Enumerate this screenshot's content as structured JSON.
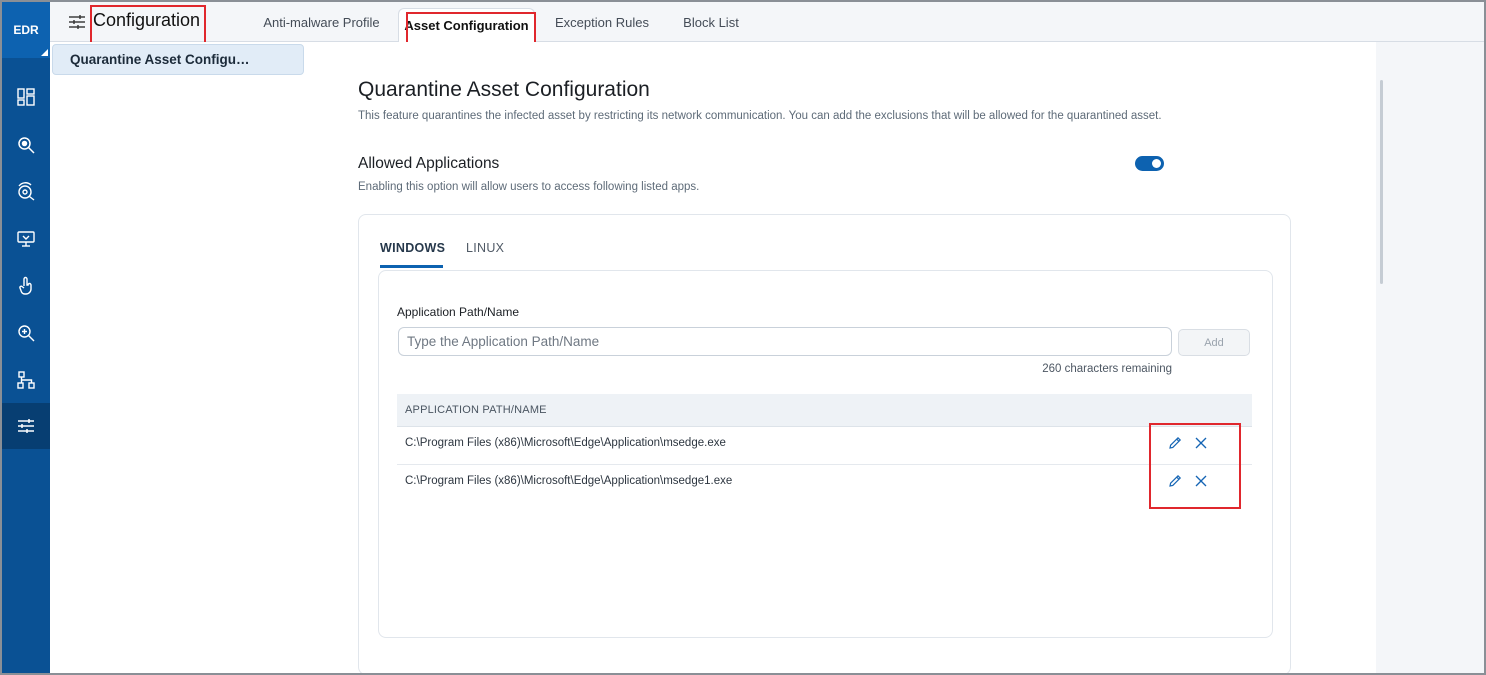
{
  "rail": {
    "brand": "EDR",
    "items": [
      {
        "icon": "dashboard-icon"
      },
      {
        "icon": "threat-search-icon"
      },
      {
        "icon": "investigate-icon"
      },
      {
        "icon": "assets-icon"
      },
      {
        "icon": "response-icon"
      },
      {
        "icon": "threat-hunting-icon"
      },
      {
        "icon": "network-icon"
      },
      {
        "icon": "configuration-icon",
        "active": true
      }
    ]
  },
  "header": {
    "title": "Configuration",
    "tabs": [
      {
        "label": "Anti-malware Profile"
      },
      {
        "label": "Asset Configuration",
        "active": true
      },
      {
        "label": "Exception Rules"
      },
      {
        "label": "Block List"
      }
    ]
  },
  "subnav": {
    "items": [
      {
        "label": "Quarantine Asset Configu…",
        "active": true
      }
    ]
  },
  "main": {
    "title": "Quarantine Asset Configuration",
    "description": "This feature quarantines the infected asset by restricting its network communication. You can add the exclusions that will be allowed for the quarantined asset.",
    "allowed_apps": {
      "title": "Allowed Applications",
      "description": "Enabling this option will allow users to access following listed apps.",
      "enabled": true
    },
    "os_tabs": [
      {
        "label": "WINDOWS",
        "active": true
      },
      {
        "label": "LINUX"
      }
    ],
    "form": {
      "label": "Application Path/Name",
      "placeholder": "Type the Application Path/Name",
      "value": "",
      "add_label": "Add",
      "char_count": "260 characters remaining"
    },
    "table": {
      "header": "APPLICATION PATH/NAME",
      "rows": [
        {
          "path": "C:\\Program Files (x86)\\Microsoft\\Edge\\Application\\msedge.exe"
        },
        {
          "path": "C:\\Program Files (x86)\\Microsoft\\Edge\\Application\\msedge1.exe"
        }
      ]
    }
  },
  "colors": {
    "rail": "#0a5194",
    "accent": "#0d62b0",
    "highlight_box": "#e0272d"
  }
}
